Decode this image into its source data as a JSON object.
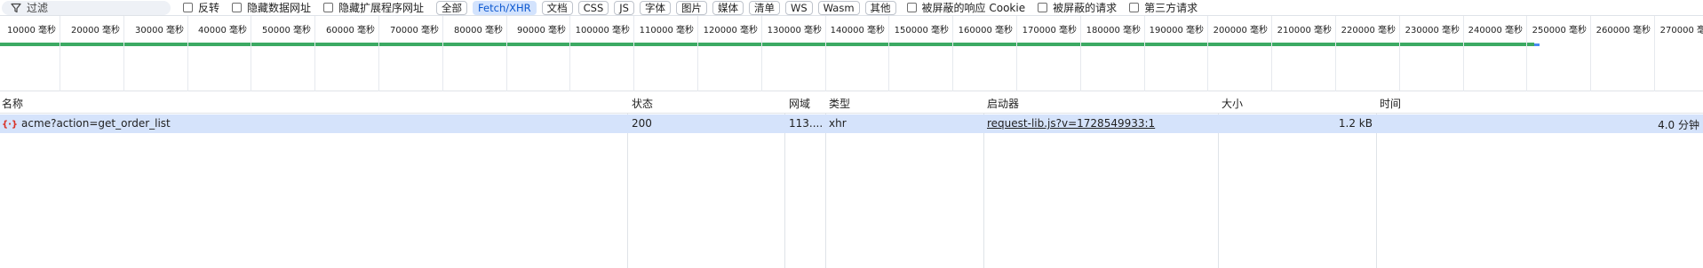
{
  "filter": {
    "placeholder": "过滤",
    "invert_label": "反转",
    "hide_data_urls_label": "隐藏数据网址",
    "hide_extension_urls_label": "隐藏扩展程序网址"
  },
  "type_chips": [
    {
      "label": "全部",
      "active": false
    },
    {
      "label": "Fetch/XHR",
      "active": true
    },
    {
      "label": "文档",
      "active": false
    },
    {
      "label": "CSS",
      "active": false
    },
    {
      "label": "JS",
      "active": false
    },
    {
      "label": "字体",
      "active": false
    },
    {
      "label": "图片",
      "active": false
    },
    {
      "label": "媒体",
      "active": false
    },
    {
      "label": "清单",
      "active": false
    },
    {
      "label": "WS",
      "active": false
    },
    {
      "label": "Wasm",
      "active": false
    },
    {
      "label": "其他",
      "active": false
    }
  ],
  "extra_filters": {
    "blocked_cookies_label": "被屏蔽的响应 Cookie",
    "blocked_requests_label": "被屏蔽的请求",
    "third_party_label": "第三方请求"
  },
  "timeline": {
    "ticks": [
      "10000 毫秒",
      "20000 毫秒",
      "30000 毫秒",
      "40000 毫秒",
      "50000 毫秒",
      "60000 毫秒",
      "70000 毫秒",
      "80000 毫秒",
      "90000 毫秒",
      "100000 毫秒",
      "110000 毫秒",
      "120000 毫秒",
      "130000 毫秒",
      "140000 毫秒",
      "150000 毫秒",
      "160000 毫秒",
      "170000 毫秒",
      "180000 毫秒",
      "190000 毫秒",
      "200000 毫秒",
      "210000 毫秒",
      "220000 毫秒",
      "230000 毫秒",
      "240000 毫秒",
      "250000 毫秒",
      "260000 毫秒",
      "270000 毫秒"
    ],
    "bar_color": "#3caa63",
    "bar_end_color": "#4a8af4"
  },
  "columns": {
    "name": "名称",
    "status": "状态",
    "domain": "网域",
    "type": "类型",
    "initiator": "启动器",
    "size": "大小",
    "time": "时间"
  },
  "requests": [
    {
      "icon": "xhr-icon",
      "name": "acme?action=get_order_list",
      "status": "200",
      "domain": "113....",
      "type": "xhr",
      "initiator": "request-lib.js?v=1728549933:1",
      "size": "1.2 kB",
      "time": "4.0 分钟"
    }
  ],
  "colors": {
    "selected_row": "#d5e3fb",
    "active_chip_bg": "#d3e3fd",
    "active_chip_text": "#0b57d0"
  }
}
